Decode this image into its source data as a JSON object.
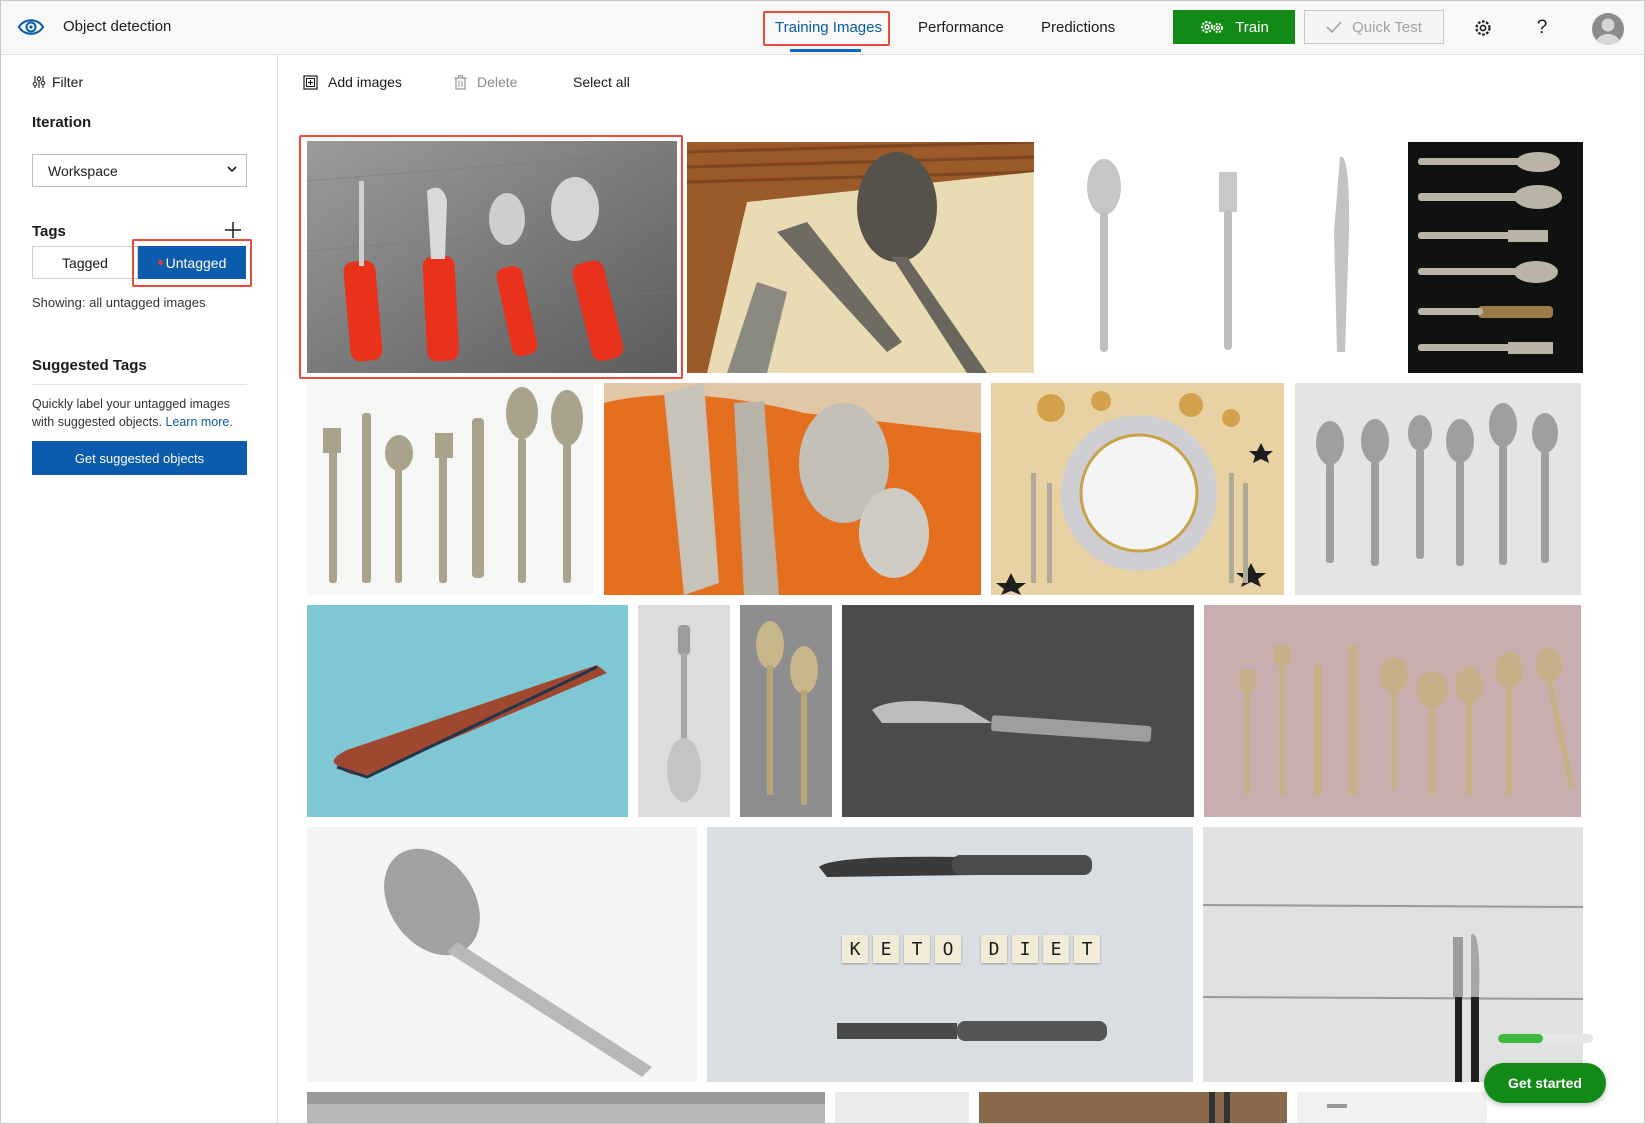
{
  "app": {
    "title": "Object detection"
  },
  "nav": {
    "tabs": [
      {
        "label": "Training Images",
        "active": true
      },
      {
        "label": "Performance",
        "active": false
      },
      {
        "label": "Predictions",
        "active": false
      }
    ],
    "train_label": "Train",
    "quick_test_label": "Quick Test"
  },
  "sidebar": {
    "filter_label": "Filter",
    "iteration_heading": "Iteration",
    "iteration_value": "Workspace",
    "tags_heading": "Tags",
    "tagged_label": "Tagged",
    "untagged_label": "Untagged",
    "showing_text": "Showing: all untagged images",
    "suggested_heading": "Suggested Tags",
    "suggested_text": "Quickly label your untagged images with suggested objects.",
    "learn_more": "Learn more.",
    "suggest_button": "Get suggested objects"
  },
  "toolbar": {
    "add_images": "Add images",
    "delete": "Delete",
    "select_all": "Select all"
  },
  "gallery": {
    "keto_tiles": [
      "K",
      "E",
      "T",
      "O",
      "D",
      "I",
      "E",
      "T"
    ]
  },
  "onboarding": {
    "progress_fraction": 0.47,
    "get_started": "Get started"
  },
  "colors": {
    "accent_blue": "#0b5cad",
    "train_green": "#128a16",
    "highlight_red": "#e74c3c"
  }
}
